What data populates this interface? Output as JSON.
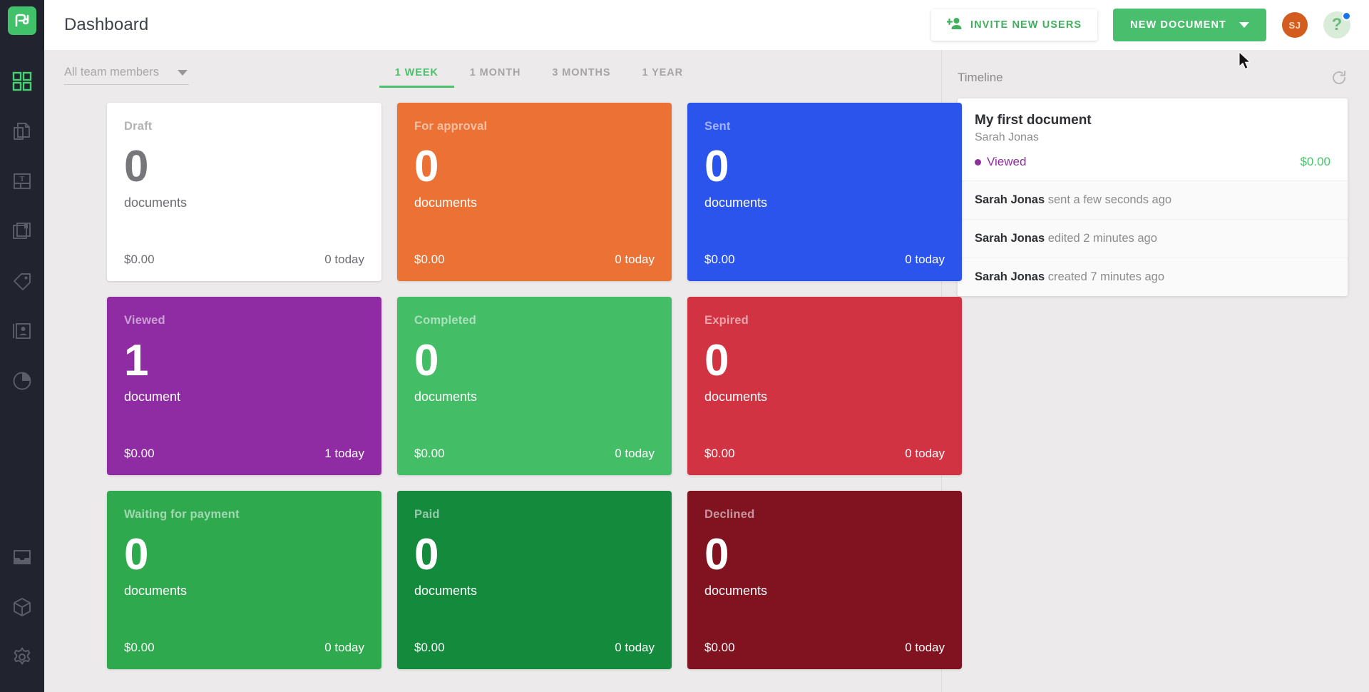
{
  "sidebar": {
    "logo_alt": "pandadoc-logo",
    "items": [
      {
        "name": "dashboard",
        "icon": "grid-icon",
        "active": true
      },
      {
        "name": "documents",
        "icon": "documents-icon",
        "active": false
      },
      {
        "name": "templates",
        "icon": "template-icon",
        "active": false
      },
      {
        "name": "catalog",
        "icon": "catalog-book-icon",
        "active": false
      },
      {
        "name": "pricing",
        "icon": "tag-icon",
        "active": false
      },
      {
        "name": "contacts",
        "icon": "contact-card-icon",
        "active": false
      },
      {
        "name": "reports",
        "icon": "pie-chart-icon",
        "active": false
      }
    ],
    "bottom_items": [
      {
        "name": "inbox",
        "icon": "inbox-tray-icon",
        "active": false
      },
      {
        "name": "integrations",
        "icon": "cube-icon",
        "active": false
      },
      {
        "name": "settings",
        "icon": "gear-icon",
        "active": false
      }
    ]
  },
  "header": {
    "title": "Dashboard",
    "invite_label": "INVITE NEW USERS",
    "new_document_label": "NEW DOCUMENT",
    "avatar_initials": "SJ",
    "help_label": "?"
  },
  "filters": {
    "team_placeholder": "All team members",
    "periods": [
      {
        "label": "1 WEEK",
        "active": true
      },
      {
        "label": "1 MONTH",
        "active": false
      },
      {
        "label": "3 MONTHS",
        "active": false
      },
      {
        "label": "1 YEAR",
        "active": false
      }
    ]
  },
  "cards": [
    {
      "label": "Draft",
      "count": "0",
      "unit": "documents",
      "amount": "$0.00",
      "today": "0 today",
      "bg": "#ffffff",
      "style": "light"
    },
    {
      "label": "For approval",
      "count": "0",
      "unit": "documents",
      "amount": "$0.00",
      "today": "0 today",
      "bg": "#ec7134",
      "style": "tinted"
    },
    {
      "label": "Sent",
      "count": "0",
      "unit": "documents",
      "amount": "$0.00",
      "today": "0 today",
      "bg": "#2b54ec",
      "style": "tinted"
    },
    {
      "label": "Viewed",
      "count": "1",
      "unit": "document",
      "amount": "$0.00",
      "today": "1 today",
      "bg": "#8f2ba3",
      "style": "tinted"
    },
    {
      "label": "Completed",
      "count": "0",
      "unit": "documents",
      "amount": "$0.00",
      "today": "0 today",
      "bg": "#43bd66",
      "style": "tinted"
    },
    {
      "label": "Expired",
      "count": "0",
      "unit": "documents",
      "amount": "$0.00",
      "today": "0 today",
      "bg": "#d13343",
      "style": "tinted"
    },
    {
      "label": "Waiting for payment",
      "count": "0",
      "unit": "documents",
      "amount": "$0.00",
      "today": "0 today",
      "bg": "#2fa94e",
      "style": "tinted"
    },
    {
      "label": "Paid",
      "count": "0",
      "unit": "documents",
      "amount": "$0.00",
      "today": "0 today",
      "bg": "#138a3c",
      "style": "tinted"
    },
    {
      "label": "Declined",
      "count": "0",
      "unit": "documents",
      "amount": "$0.00",
      "today": "0 today",
      "bg": "#81121f",
      "style": "tinted"
    }
  ],
  "timeline": {
    "title": "Timeline",
    "refresh_icon": "refresh-icon",
    "document": {
      "title": "My first document",
      "author": "Sarah Jonas",
      "status": "Viewed",
      "status_color": "#8e2f9e",
      "amount": "$0.00",
      "amount_color": "#4cc06c"
    },
    "events": [
      {
        "actor": "Sarah Jonas",
        "text": " sent a few seconds ago"
      },
      {
        "actor": "Sarah Jonas",
        "text": " edited 2 minutes ago"
      },
      {
        "actor": "Sarah Jonas",
        "text": " created 7 minutes ago"
      }
    ]
  },
  "colors": {
    "brand_green": "#49be6d",
    "sidebar_bg": "#21232e",
    "page_bg": "#eceaea"
  }
}
